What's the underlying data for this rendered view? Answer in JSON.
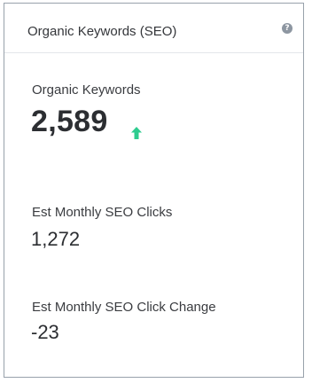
{
  "widget": {
    "title": "Organic Keywords (SEO)",
    "help_icon": "question-circle-icon",
    "help_icon_glyph": "?"
  },
  "metrics": [
    {
      "label": "Organic Keywords",
      "value": "2,589",
      "trend_icon": "arrow-up-icon",
      "trend_color": "#2ecc8f"
    },
    {
      "label": "Est Monthly SEO Clicks",
      "value": "1,272"
    },
    {
      "label": "Est Monthly SEO Click Change",
      "value": "-23"
    }
  ],
  "colors": {
    "border": "#98a1ab",
    "text": "#2f3033",
    "help_icon_bg": "#8d96a1"
  }
}
